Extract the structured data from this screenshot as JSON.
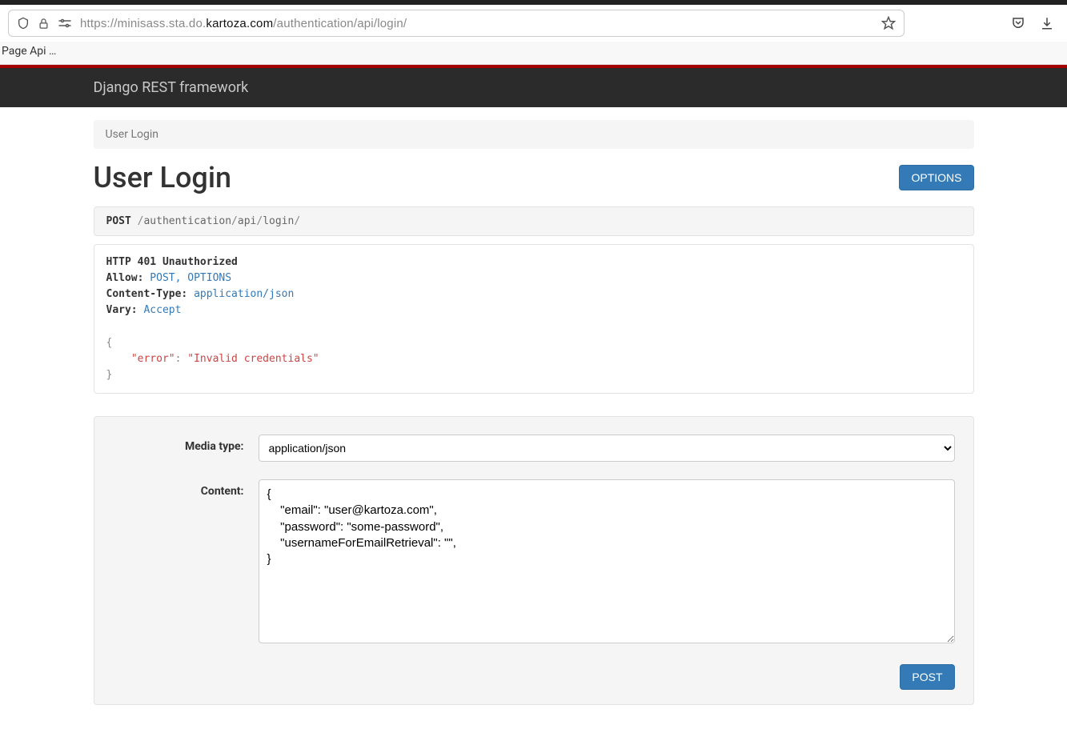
{
  "browser": {
    "url_proto": "https://",
    "url_host_pre": "minisass.sta.do.",
    "url_host_bold": "kartoza.com",
    "url_path": "/authentication/api/login/",
    "bookmark": "Page Api …"
  },
  "navbar": {
    "brand": "Django REST framework"
  },
  "breadcrumb": {
    "item": "User Login"
  },
  "page": {
    "title": "User Login",
    "options_btn": "OPTIONS"
  },
  "request": {
    "method": "POST",
    "segments": [
      "authentication",
      "api",
      "login"
    ]
  },
  "response": {
    "status": "HTTP 401 Unauthorized",
    "headers": [
      {
        "k": "Allow:",
        "v": "POST, OPTIONS"
      },
      {
        "k": "Content-Type:",
        "v": "application/json"
      },
      {
        "k": "Vary:",
        "v": "Accept"
      }
    ],
    "body_key": "\"error\"",
    "body_val": "\"Invalid credentials\""
  },
  "form": {
    "media_label": "Media type:",
    "media_value": "application/json",
    "content_label": "Content:",
    "content_value": "{\n    \"email\": \"user@kartoza.com\",\n    \"password\": \"some-password\",\n    \"usernameForEmailRetrieval\": \"\",\n}",
    "post_btn": "POST"
  }
}
